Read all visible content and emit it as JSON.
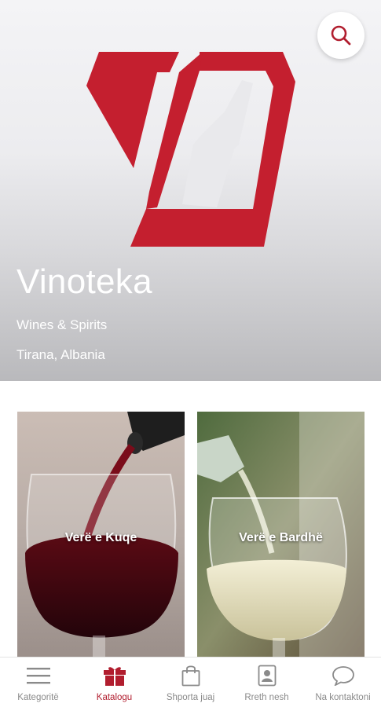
{
  "header": {
    "title": "Vinoteka",
    "subtitle": "Wines & Spirits",
    "location": "Tirana, Albania",
    "brand_color": "#c41f2f",
    "search_icon": "search-icon"
  },
  "categories": [
    {
      "label": "Verë e Kuqe"
    },
    {
      "label": "Verë e Bardhë"
    }
  ],
  "bottom_nav": {
    "active_color": "#b11d2e",
    "inactive_color": "#8a8a8a",
    "items": [
      {
        "label": "Kategoritë",
        "icon": "menu-icon",
        "active": false
      },
      {
        "label": "Katalogu",
        "icon": "gift-box-icon",
        "active": true
      },
      {
        "label": "Shporta juaj",
        "icon": "shopping-bag-icon",
        "active": false
      },
      {
        "label": "Rreth nesh",
        "icon": "contact-card-icon",
        "active": false
      },
      {
        "label": "Na kontaktoni",
        "icon": "chat-bubble-icon",
        "active": false
      }
    ]
  }
}
